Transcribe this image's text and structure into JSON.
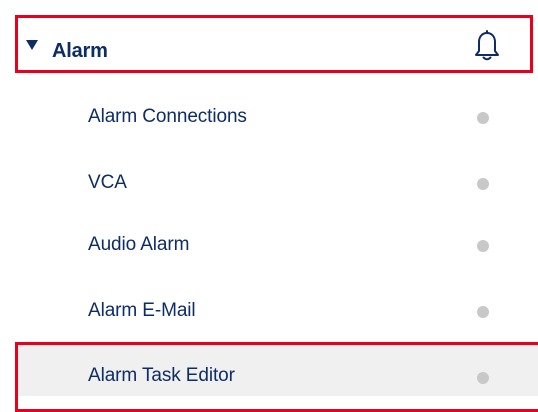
{
  "section": {
    "title": "Alarm",
    "expanded": true,
    "caret_icon": "caret-down-icon",
    "bell_icon": "bell-icon"
  },
  "items": [
    {
      "label": "Alarm Connections",
      "status_icon": "status-dot-icon",
      "status_color": "#c8c8c8",
      "active": false
    },
    {
      "label": "VCA",
      "status_icon": "status-dot-icon",
      "status_color": "#c8c8c8",
      "active": false
    },
    {
      "label": "Audio Alarm",
      "status_icon": "status-dot-icon",
      "status_color": "#c8c8c8",
      "active": false
    },
    {
      "label": "Alarm E-Mail",
      "status_icon": "status-dot-icon",
      "status_color": "#c8c8c8",
      "active": false
    },
    {
      "label": "Alarm Task Editor",
      "status_icon": "status-dot-icon",
      "status_color": "#c8c8c8",
      "active": true
    }
  ],
  "colors": {
    "text": "#0e2d64",
    "highlight_border": "#e8001c",
    "active_background": "#f0f0f0",
    "status_dot": "#c8c8c8"
  }
}
